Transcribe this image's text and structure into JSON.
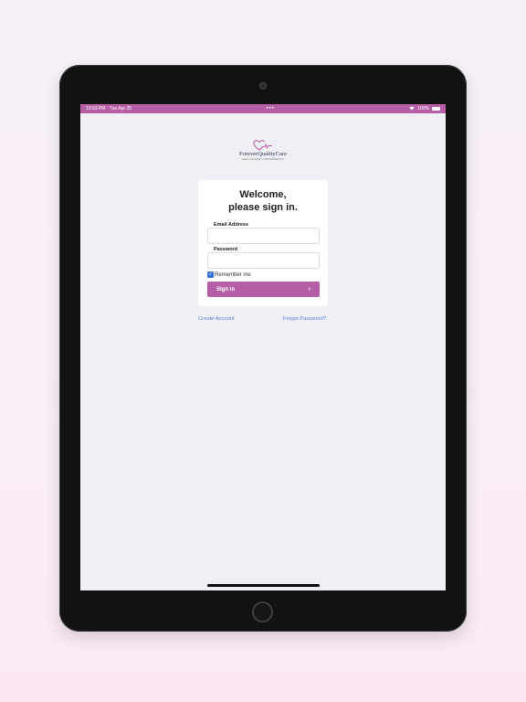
{
  "status_bar": {
    "time_date": "10:53 PM · Tue Apr 25",
    "center_dots": "•••",
    "battery_text": "100%"
  },
  "logo": {
    "name": "ForeverQualityCare",
    "tagline": "HEALTHCARE INDEPENDENCE"
  },
  "login": {
    "welcome_line1": "Welcome,",
    "welcome_line2": "please sign in.",
    "email_label": "Email Address",
    "email_value": "",
    "password_label": "Password",
    "password_value": "",
    "remember_label": "Remember me",
    "remember_checked": true,
    "signin_label": "Sign in"
  },
  "links": {
    "create_account": "Create Account",
    "forgot_password": "Forgot Password?"
  },
  "colors": {
    "brand": "#b65fa6",
    "link": "#5b7fd1",
    "checkbox": "#3b73d9"
  }
}
